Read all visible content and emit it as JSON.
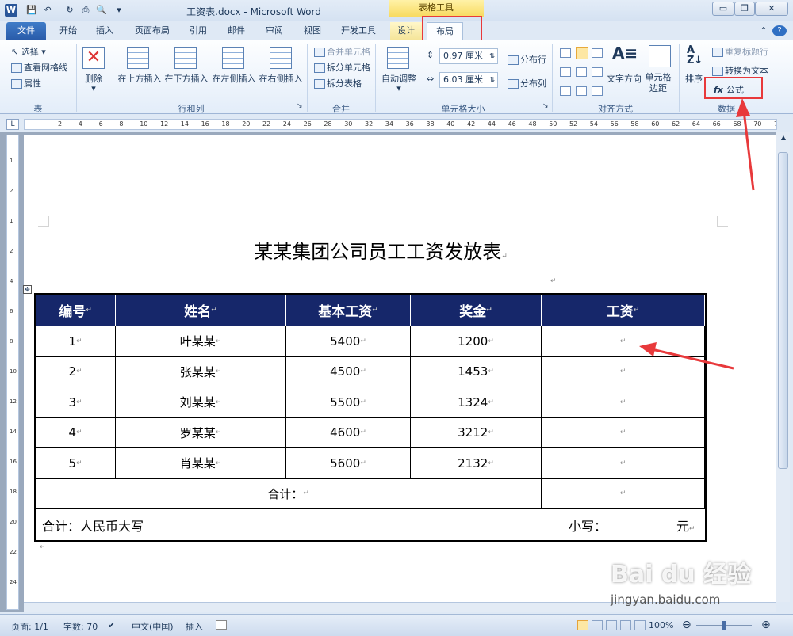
{
  "window": {
    "title": "工资表.docx - Microsoft Word",
    "context_group": "表格工具"
  },
  "quick_access": [
    "save-icon",
    "undo-icon",
    "redo-icon",
    "print-icon",
    "preview-icon"
  ],
  "tabs": [
    "文件",
    "开始",
    "插入",
    "页面布局",
    "引用",
    "邮件",
    "审阅",
    "视图",
    "开发工具",
    "设计",
    "布局"
  ],
  "ribbon": {
    "table_group": {
      "label": "表",
      "items": [
        "选择",
        "查看网格线",
        "属性"
      ]
    },
    "rows_cols": {
      "label": "行和列",
      "delete": "删除",
      "insert_above": "在上方插入",
      "insert_below": "在下方插入",
      "insert_left": "在左侧插入",
      "insert_right": "在右侧插入"
    },
    "merge": {
      "label": "合并",
      "items": [
        "合并单元格",
        "拆分单元格",
        "拆分表格"
      ]
    },
    "cell_size": {
      "label": "单元格大小",
      "autofit": "自动调整",
      "height": "0.97 厘米",
      "width": "6.03 厘米",
      "dist_rows": "分布行",
      "dist_cols": "分布列"
    },
    "alignment": {
      "label": "对齐方式",
      "text_direction": "文字方向",
      "cell_margins": "单元格边距"
    },
    "data": {
      "label": "数据",
      "sort": "排序",
      "repeat_header": "重复标题行",
      "to_text": "转换为文本",
      "formula": "公式"
    }
  },
  "ruler": [
    "2",
    "4",
    "6",
    "8",
    "10",
    "12",
    "14",
    "16",
    "18",
    "20",
    "22",
    "24",
    "26",
    "28",
    "30",
    "32",
    "34",
    "36",
    "38",
    "40",
    "42",
    "44",
    "46",
    "48",
    "50",
    "52",
    "54",
    "56",
    "58",
    "60",
    "62",
    "64",
    "66",
    "68",
    "70",
    "72"
  ],
  "vruler": [
    "1",
    "2",
    "1",
    "2",
    "4",
    "6",
    "8",
    "10",
    "12",
    "14",
    "16",
    "18",
    "20",
    "22",
    "24"
  ],
  "document": {
    "heading": "某某集团公司员工工资发放表",
    "table": {
      "headers": [
        "编号",
        "姓名",
        "基本工资",
        "奖金",
        "工资"
      ],
      "rows": [
        [
          "1",
          "叶某某",
          "5400",
          "1200",
          ""
        ],
        [
          "2",
          "张某某",
          "4500",
          "1453",
          ""
        ],
        [
          "3",
          "刘某某",
          "5500",
          "1324",
          ""
        ],
        [
          "4",
          "罗某某",
          "4600",
          "3212",
          ""
        ],
        [
          "5",
          "肖某某",
          "5600",
          "2132",
          ""
        ]
      ],
      "total_label": "合计：",
      "rmb_label": "合计：人民币大写",
      "small_label": "小写：",
      "yuan": "元"
    }
  },
  "status": {
    "page": "页面: 1/1",
    "words": "字数: 70",
    "language": "中文(中国)",
    "mode": "插入",
    "zoom": "100%"
  },
  "watermark": {
    "brand": "Bai du 经验",
    "url": "jingyan.baidu.com"
  }
}
